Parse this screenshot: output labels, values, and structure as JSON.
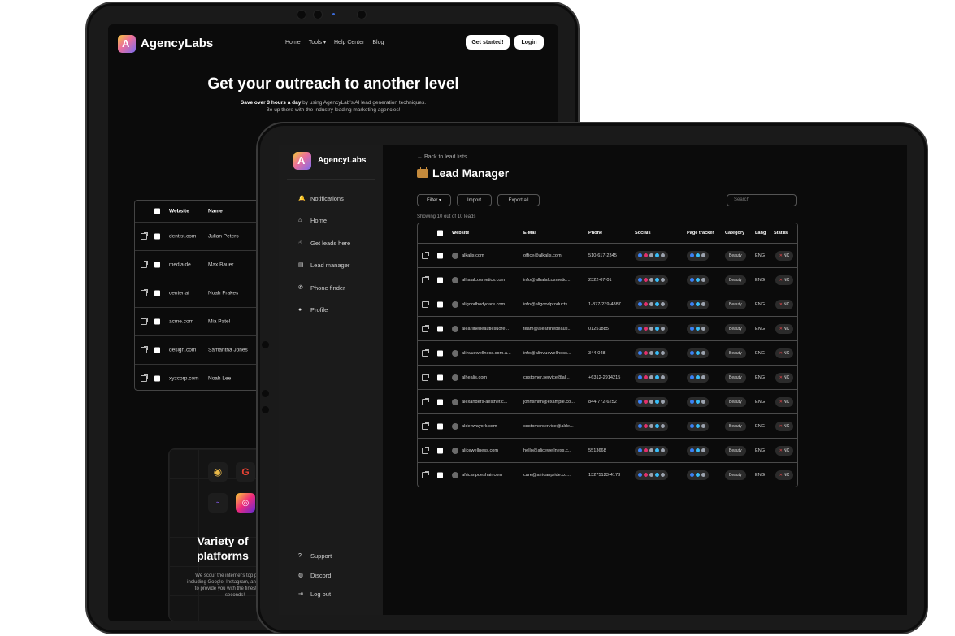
{
  "brand": "AgencyLabs",
  "back": {
    "nav": {
      "links": [
        "Home",
        "Tools",
        "Help Center",
        "Blog"
      ],
      "tools_caret": "▾",
      "cta_get_started": "Get started!",
      "cta_login": "Login"
    },
    "hero": {
      "title": "Get your outreach to another level",
      "sub_bold": "Save over 3 hours a day",
      "sub_rest": " by using AgencyLab's AI lead generation techniques.",
      "sub_line2": "Be up there with the industry leading marketing agencies!"
    },
    "table": {
      "headers": [
        "Website",
        "Name"
      ],
      "rows": [
        {
          "website": "dentist.com",
          "name": "Julian Peters"
        },
        {
          "website": "media.de",
          "name": "Max Bauer"
        },
        {
          "website": "center.ai",
          "name": "Noah Frakes"
        },
        {
          "website": "acme.com",
          "name": "Mia Patel"
        },
        {
          "website": "design.com",
          "name": "Samantha Jones"
        },
        {
          "website": "xyzcorp.com",
          "name": "Noah Lee"
        }
      ]
    },
    "platforms_card": {
      "title_line1": "Variety of",
      "title_line2": "platforms",
      "body": "We scour the internet's top platforms including Google, Instagram, and Facebook, to provide you with the finest leads in seconds!"
    }
  },
  "front": {
    "sidebar": {
      "items": [
        {
          "label": "Notifications",
          "icon": "bell-icon"
        },
        {
          "label": "Home",
          "icon": "home-icon"
        },
        {
          "label": "Get leads here",
          "icon": "hand-pointer-icon"
        },
        {
          "label": "Lead manager",
          "icon": "document-icon"
        },
        {
          "label": "Phone finder",
          "icon": "phone-icon"
        },
        {
          "label": "Profile",
          "icon": "user-icon"
        }
      ],
      "bottom": [
        {
          "label": "Support",
          "icon": "help-icon"
        },
        {
          "label": "Discord",
          "icon": "discord-icon"
        },
        {
          "label": "Log out",
          "icon": "logout-icon"
        }
      ]
    },
    "back_link": "← Back to lead lists",
    "title": "Lead Manager",
    "toolbar": {
      "filter": "Filter",
      "filter_caret": "▾",
      "import": "Import",
      "export": "Export all",
      "search_placeholder": "Search"
    },
    "count_text": "Showing 10 out of 10 leads",
    "columns": [
      "Website",
      "E-Mail",
      "Phone",
      "Socials",
      "Page tracker",
      "Category",
      "Lang",
      "Status"
    ],
    "rows": [
      {
        "website": "alkalis.com",
        "email": "office@alkalis.com",
        "phone": "510-617-2345",
        "category": "Beauty",
        "lang": "ENG",
        "status": "NC"
      },
      {
        "website": "alhalalcosmetics.com",
        "email": "info@alhalalcosmetic...",
        "phone": "2322-07-01",
        "category": "Beauty",
        "lang": "ENG",
        "status": "NC"
      },
      {
        "website": "aligoodbodycare.com",
        "email": "info@aligoodproducts...",
        "phone": "1-877-239-4887",
        "category": "Beauty",
        "lang": "ENG",
        "status": "NC"
      },
      {
        "website": "alearlinebeautiesuore...",
        "email": "team@alearlinebeauti...",
        "phone": "01251885",
        "category": "Beauty",
        "lang": "ENG",
        "status": "NC"
      },
      {
        "website": "alinvuewellness.com.a...",
        "email": "info@alinvuewellness...",
        "phone": "344-048",
        "category": "Beauty",
        "lang": "ENG",
        "status": "NC"
      },
      {
        "website": "alhealis.com",
        "email": "customer.service@al...",
        "phone": "+6312-2914215",
        "category": "Beauty",
        "lang": "ENG",
        "status": "NC"
      },
      {
        "website": "alexanders-aesthetic...",
        "email": "johnsmith@example.co...",
        "phone": "844-772-6252",
        "category": "Beauty",
        "lang": "ENG",
        "status": "NC"
      },
      {
        "website": "aldenwayork.com",
        "email": "customerservice@alde...",
        "phone": "",
        "category": "Beauty",
        "lang": "ENG",
        "status": "NC"
      },
      {
        "website": "alicewellness.com",
        "email": "hello@alicewellness.c...",
        "phone": "5513668",
        "category": "Beauty",
        "lang": "ENG",
        "status": "NC"
      },
      {
        "website": "africanpdeshair.com",
        "email": "care@africanpride.co...",
        "phone": "13275123-4173",
        "category": "Beauty",
        "lang": "ENG",
        "status": "NC"
      }
    ],
    "status_icon": "✕"
  },
  "colors": {
    "logo_gradient": [
      "#f3c83b",
      "#ec6f9b",
      "#7b6cf0"
    ],
    "facebook": "#3b82f6",
    "instagram": "#e1306c",
    "twitter": "#38bdf8",
    "tiktok": "#9ca3af",
    "status_red": "#e5484d"
  }
}
